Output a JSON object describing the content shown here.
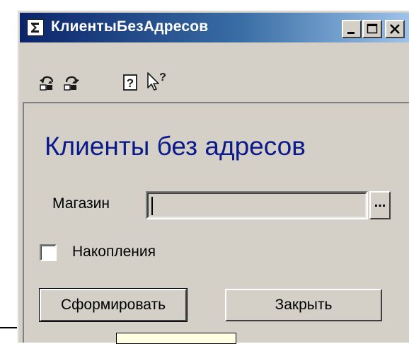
{
  "window": {
    "title": "КлиентыБезАдресов",
    "controls": [
      "minimize-icon",
      "maximize-icon",
      "close-icon"
    ]
  },
  "toolbar": {
    "tools": [
      "undo-icon",
      "redo-icon",
      "help-icon",
      "whats-this-icon"
    ]
  },
  "form": {
    "heading": "Клиенты без адресов",
    "shop_label": "Магазин",
    "shop_value": "",
    "shop_select_label": "...",
    "accumulations_label": "Накопления",
    "accumulations_checked": false,
    "build_button": "Сформировать",
    "close_button": "Закрыть"
  },
  "colors": {
    "heading": "#0a1a8a",
    "title_bar_start": "#0a246a",
    "title_bar_end": "#a6caf0",
    "face": "#d4d0c8"
  }
}
